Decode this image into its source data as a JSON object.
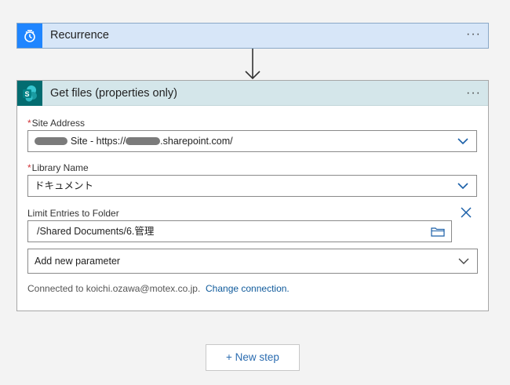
{
  "recurrence": {
    "title": "Recurrence",
    "more": "···"
  },
  "get_files": {
    "title": "Get files (properties only)",
    "more": "···",
    "site_address": {
      "label": "Site Address",
      "required": "*",
      "value_prefix": "Site - https://",
      "value_suffix": ".sharepoint.com/"
    },
    "library_name": {
      "label": "Library Name",
      "required": "*",
      "value": "ドキュメント"
    },
    "limit_folder": {
      "label": "Limit Entries to Folder",
      "value": "/Shared Documents/6.管理"
    },
    "add_param": {
      "label": "Add new parameter"
    },
    "connection": {
      "text": "Connected to koichi.ozawa@motex.co.jp.",
      "link": "Change connection."
    }
  },
  "new_step": {
    "label": "+ New step"
  },
  "colors": {
    "recurrence_icon_bg": "#1f85ff",
    "sharepoint_icon_bg": "#036c70",
    "accent_blue": "#0f5a9b",
    "required_red": "#d13438"
  }
}
